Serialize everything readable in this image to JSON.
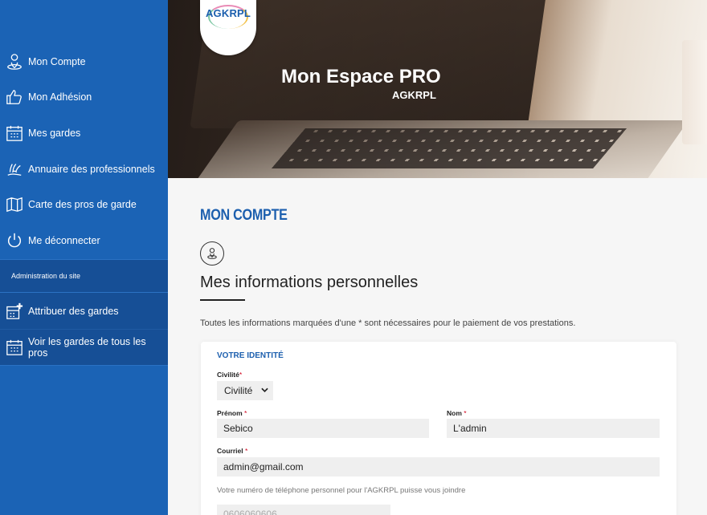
{
  "sidebar": {
    "items": [
      {
        "label": "Mon Compte",
        "icon": "user-pin-icon"
      },
      {
        "label": "Mon Adhésion",
        "icon": "thumbs-up-icon"
      },
      {
        "label": "Mes gardes",
        "icon": "calendar-icon"
      },
      {
        "label": "Annuaire des professionnels",
        "icon": "wave-hand-icon"
      },
      {
        "label": "Carte des pros de garde",
        "icon": "map-icon"
      },
      {
        "label": "Me déconnecter",
        "icon": "power-icon"
      }
    ],
    "admin_heading": "Administration du site",
    "admin_items": [
      {
        "label": "Attribuer des gardes",
        "icon": "calendar-plus-icon"
      },
      {
        "label": "Voir les gardes de tous les pros",
        "icon": "calendar-icon"
      }
    ]
  },
  "logo": {
    "text": "AGKRPL"
  },
  "hero": {
    "title": "Mon Espace PRO",
    "subtitle": "AGKRPL"
  },
  "main": {
    "page_title": "MON COMPTE",
    "section_title": "Mes informations personnelles",
    "intro": "Toutes les informations marquées d'une * sont nécessaires pour le paiement de vos prestations."
  },
  "form": {
    "card_title": "VOTRE IDENTITÉ",
    "civilite": {
      "label": "Civilité",
      "req": "*",
      "value": "Civilité"
    },
    "prenom": {
      "label": "Prénom",
      "req": "*",
      "value": "Sebico"
    },
    "nom": {
      "label": "Nom",
      "req": "*",
      "value": "L'admin"
    },
    "courriel": {
      "label": "Courriel",
      "req": "*",
      "value": "admin@gmail.com"
    },
    "phone_hint": "Votre numéro de téléphone personnel pour l'AGKRPL puisse vous joindre",
    "phone_placeholder": "0606060606"
  },
  "colors": {
    "sidebar": "#1b63b5",
    "accent": "#1c5fae",
    "required": "#d0021b"
  }
}
